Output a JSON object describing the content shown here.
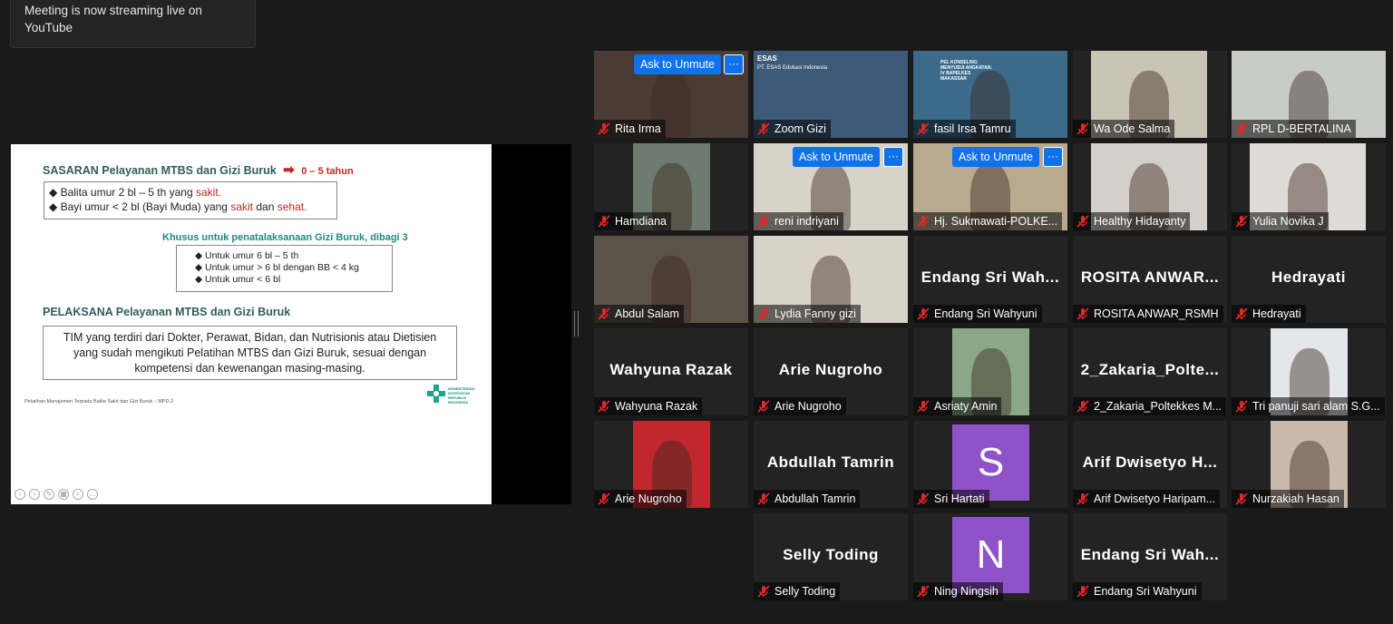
{
  "notification": {
    "text": "Meeting is now streaming live on YouTube"
  },
  "slide": {
    "heading1": "SASARAN Pelayanan MTBS dan Gizi Buruk",
    "heading1_arrow": "➡",
    "heading1_age": "0 – 5 tahun",
    "box1": {
      "line1_prefix": "Balita umur 2 bl – 5 th yang ",
      "line1_red": "sakit.",
      "line2_prefix": "Bayi umur < 2 bl (Bayi Muda) yang ",
      "line2_red1": "sakit",
      "line2_mid": " dan ",
      "line2_red2": "sehat."
    },
    "subheading": "Khusus untuk penatalaksanaan Gizi Buruk, dibagi 3",
    "box2": [
      "Untuk umur 6 bl – 5 th",
      "Untuk umur > 6 bl dengan BB < 4 kg",
      "Untuk umur < 6 bl"
    ],
    "heading2": "PELAKSANA Pelayanan MTBS dan Gizi Buruk",
    "box3": "TIM yang terdiri dari Dokter, Perawat, Bidan, dan Nutrisionis atau Dietisien yang sudah mengikuti Pelatihan MTBS dan Gizi Buruk, sesuai dengan kompetensi dan kewenangan masing-masing.",
    "footer": "Pelatihan Manajemen Terpadu Balita Sakit dan Gizi Buruk – MPD.2",
    "logo_text": "KEMENTERIAN KESEHATAN REPUBLIK INDONESIA"
  },
  "controls": {
    "ask_label": "Ask to Unmute",
    "more_label": "···"
  },
  "participants": [
    {
      "name": "Rita Irma",
      "video": "photo",
      "ask": true
    },
    {
      "name": "Zoom Gizi",
      "video": "screen",
      "screen_title": "ESAS",
      "screen_sub": "PT. ESAS Edukasi Indonesia"
    },
    {
      "name": "fasil Irsa Tamru",
      "video": "photo",
      "active": true,
      "banner": "PEL KONSELING MENYUSUI ANGKATAN. IV BAPELKES MAKASSAR"
    },
    {
      "name": "Wa Ode Salma",
      "video": "photo"
    },
    {
      "name": "RPL D-BERTALINA",
      "video": "photo"
    },
    {
      "name": "Hamdiana",
      "video": "photo"
    },
    {
      "name": "reni indriyani",
      "video": "photo",
      "ask": true
    },
    {
      "name": "Hj. Sukmawati-POLKE...",
      "video": "photo",
      "ask": true
    },
    {
      "name": "Healthy Hidayanty",
      "video": "photo"
    },
    {
      "name": "Yulia Novika J",
      "video": "photo"
    },
    {
      "name": "Abdul Salam",
      "video": "photo"
    },
    {
      "name": "Lydia Fanny gizi",
      "video": "photo"
    },
    {
      "name": "Endang Sri Wahyuni",
      "video": "off",
      "display": "Endang Sri Wah..."
    },
    {
      "name": "ROSITA ANWAR_RSMH",
      "video": "off",
      "display": "ROSITA ANWAR..."
    },
    {
      "name": "Hedrayati",
      "video": "off",
      "display": "Hedrayati"
    },
    {
      "name": "Wahyuna Razak",
      "video": "off",
      "display": "Wahyuna Razak"
    },
    {
      "name": "Arie Nugroho",
      "video": "off",
      "display": "Arie Nugroho"
    },
    {
      "name": "Asriaty Amin",
      "video": "photo"
    },
    {
      "name": "2_Zakaria_Poltekkes M...",
      "video": "off",
      "display": "2_Zakaria_Polte..."
    },
    {
      "name": "Tri panuji sari alam S.G...",
      "video": "photo"
    },
    {
      "name": "Arie Nugroho",
      "video": "photo"
    },
    {
      "name": "Abdullah Tamrin",
      "video": "off",
      "display": "Abdullah Tamrin"
    },
    {
      "name": "Sri Hartati",
      "video": "avatar",
      "letter": "S"
    },
    {
      "name": "Arif Dwisetyo Haripam...",
      "video": "off",
      "display": "Arif Dwisetyo H..."
    },
    {
      "name": "Nurzakiah Hasan",
      "video": "photo"
    },
    {
      "name": "Selly Toding",
      "video": "off",
      "display": "Selly Toding"
    },
    {
      "name": "Ning Ningsih",
      "video": "avatar",
      "letter": "N"
    },
    {
      "name": "Endang Sri Wahyuni",
      "video": "off",
      "display": "Endang Sri Wah..."
    }
  ]
}
